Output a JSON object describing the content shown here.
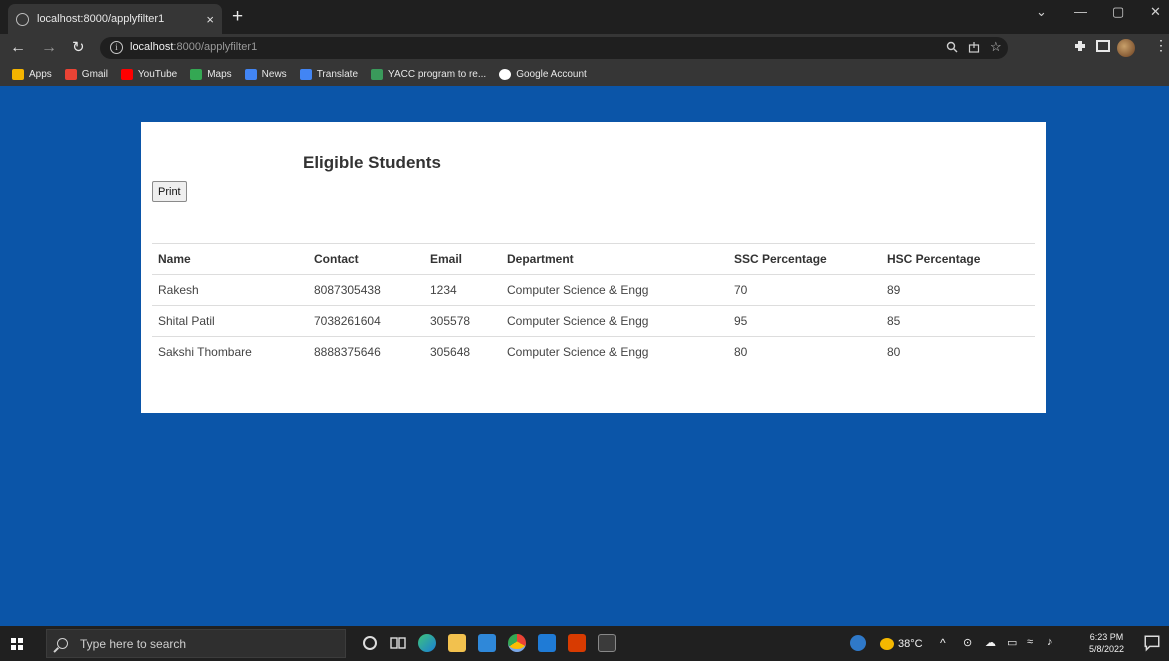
{
  "browser": {
    "tab_title": "localhost:8000/applyfilter1",
    "tab_close": "×",
    "new_tab": "+",
    "url_host": "localhost",
    "url_path": ":8000/applyfilter1",
    "window_minimize": "—",
    "window_restore": "▢",
    "window_close": "✕",
    "tab_menu": "⌄"
  },
  "bookmarks": [
    {
      "label": "Apps",
      "color": "#f4b400"
    },
    {
      "label": "Gmail",
      "color": "#ea4335"
    },
    {
      "label": "YouTube",
      "color": "#ff0000"
    },
    {
      "label": "Maps",
      "color": "#34a853"
    },
    {
      "label": "News",
      "color": "#4285f4"
    },
    {
      "label": "Translate",
      "color": "#4285f4"
    },
    {
      "label": "YACC program to re...",
      "color": "#3a9a5b"
    },
    {
      "label": "Google Account",
      "color": "#ffffff"
    }
  ],
  "page": {
    "title": "Eligible Students",
    "print_label": "Print",
    "columns": [
      "Name",
      "Contact",
      "Email",
      "Department",
      "SSC Percentage",
      "HSC Percentage"
    ],
    "rows": [
      [
        "Rakesh",
        "8087305438",
        "1234",
        "Computer Science & Engg",
        "70",
        "89"
      ],
      [
        "Shital Patil",
        "7038261604",
        "305578",
        "Computer Science & Engg",
        "95",
        "85"
      ],
      [
        "Sakshi Thombare",
        "8888375646",
        "305648",
        "Computer Science & Engg",
        "80",
        "80"
      ]
    ]
  },
  "taskbar": {
    "search_placeholder": "Type here to search",
    "weather": "38°C",
    "time": "6:23 PM",
    "date": "5/8/2022"
  },
  "colors": {
    "page_background": "#0b55a8",
    "card_background": "#ffffff"
  }
}
